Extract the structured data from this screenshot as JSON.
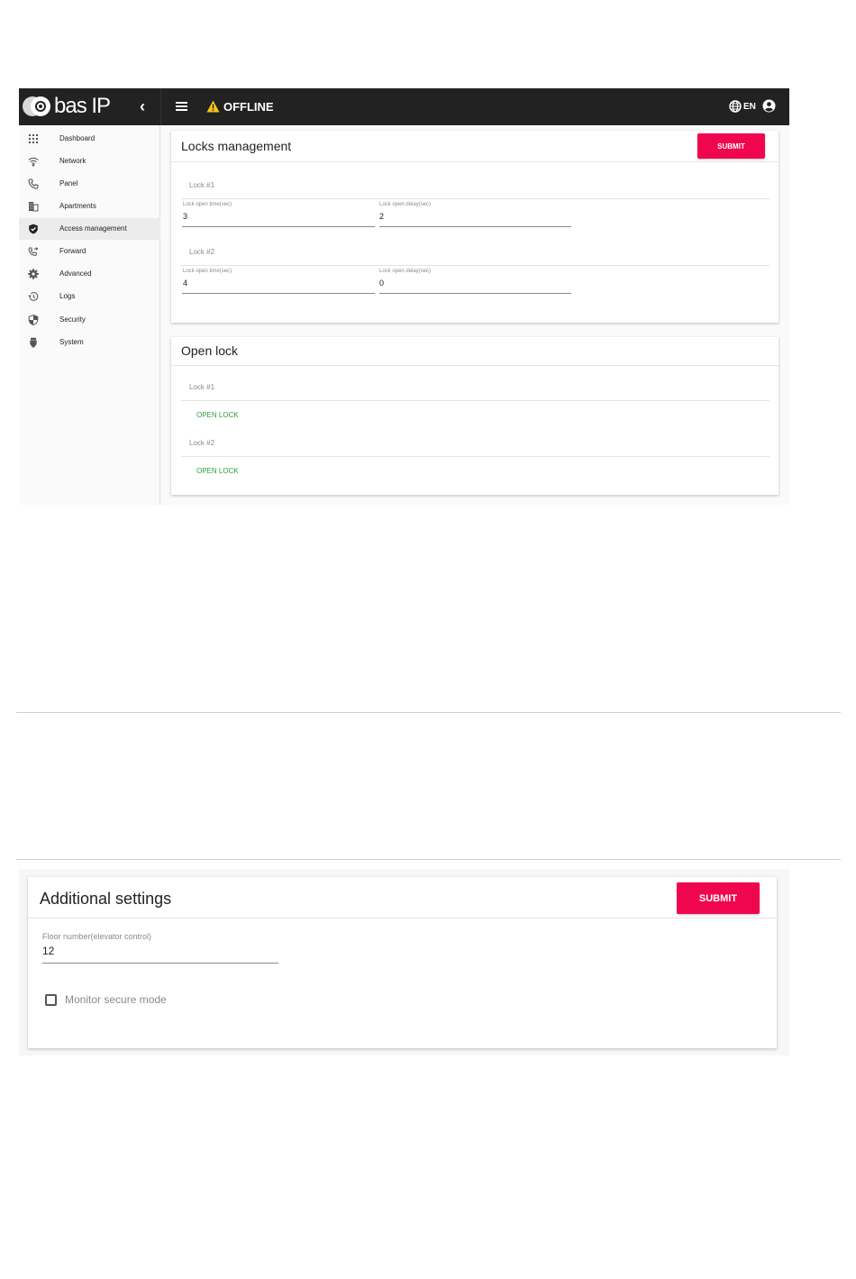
{
  "topbar": {
    "logo_text": "bas IP",
    "status": "OFFLINE",
    "language": "EN",
    "colors": {
      "bar": "#222222",
      "warning": "#f5c518",
      "accent": "#f0064f",
      "open_lock": "#2e9e3a"
    }
  },
  "sidebar": {
    "items": [
      {
        "label": "Dashboard",
        "icon": "grid-icon"
      },
      {
        "label": "Network",
        "icon": "wifi-icon"
      },
      {
        "label": "Panel",
        "icon": "phone-icon"
      },
      {
        "label": "Apartments",
        "icon": "building-icon"
      },
      {
        "label": "Access management",
        "icon": "shield-check-icon",
        "active": true
      },
      {
        "label": "Forward",
        "icon": "phone-forward-icon"
      },
      {
        "label": "Advanced",
        "icon": "gear-icon"
      },
      {
        "label": "Logs",
        "icon": "history-icon"
      },
      {
        "label": "Security",
        "icon": "security-shield-icon"
      },
      {
        "label": "System",
        "icon": "system-icon"
      }
    ]
  },
  "locks_management": {
    "title": "Locks management",
    "submit_label": "SUBMIT",
    "locks": [
      {
        "name": "Lock #1",
        "open_time_label": "Lock open time(sec)",
        "open_time": "3",
        "open_delay_label": "Lock open delay(sec)",
        "open_delay": "2"
      },
      {
        "name": "Lock #2",
        "open_time_label": "Lock open time(sec)",
        "open_time": "4",
        "open_delay_label": "Lock open delay(sec)",
        "open_delay": "0"
      }
    ]
  },
  "open_lock": {
    "title": "Open lock",
    "locks": [
      {
        "name": "Lock #1",
        "button_label": "OPEN LOCK"
      },
      {
        "name": "Lock #2",
        "button_label": "OPEN LOCK"
      }
    ]
  },
  "additional_settings": {
    "title": "Additional settings",
    "submit_label": "SUBMIT",
    "floor_label": "Floor number(elevator control)",
    "floor_value": "12",
    "monitor_secure_label": "Monitor secure mode",
    "monitor_secure_checked": false
  }
}
